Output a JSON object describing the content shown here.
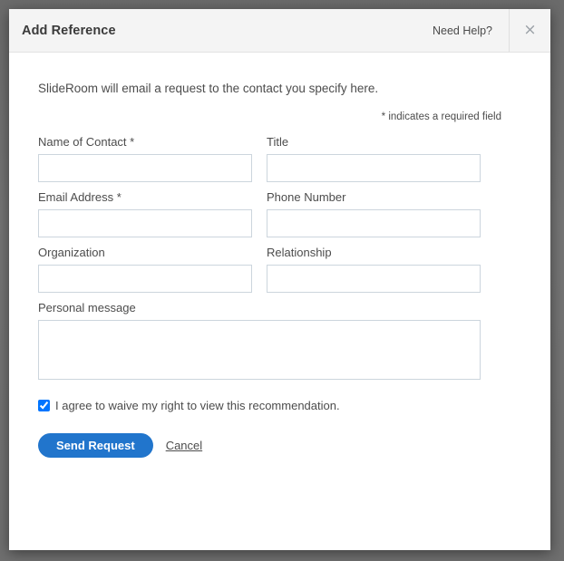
{
  "modal": {
    "title": "Add Reference",
    "need_help_label": "Need Help?",
    "close_icon": "×",
    "intro_text": "SlideRoom will email a request to the contact you specify here.",
    "required_note": "* indicates a required field"
  },
  "form": {
    "rows": [
      {
        "left": {
          "label": "Name of Contact *",
          "value": "",
          "placeholder": ""
        },
        "right": {
          "label": "Title",
          "value": "",
          "placeholder": ""
        }
      },
      {
        "left": {
          "label": "Email Address *",
          "value": "",
          "placeholder": ""
        },
        "right": {
          "label": "Phone Number",
          "value": "",
          "placeholder": ""
        }
      },
      {
        "left": {
          "label": "Organization",
          "value": "",
          "placeholder": ""
        },
        "right": {
          "label": "Relationship",
          "value": "",
          "placeholder": ""
        }
      }
    ],
    "personal_message": {
      "label": "Personal message",
      "value": "",
      "placeholder": ""
    },
    "waiver": {
      "label": "I agree to waive my right to view this recommendation.",
      "checked": true
    }
  },
  "actions": {
    "submit_label": "Send Request",
    "cancel_label": "Cancel"
  },
  "colors": {
    "accent_blue": "#2175cc",
    "header_background": "#f4f4f4",
    "backdrop": "#6e6e6e",
    "input_border": "#ccd5dd",
    "text": "#4c4c4c"
  }
}
